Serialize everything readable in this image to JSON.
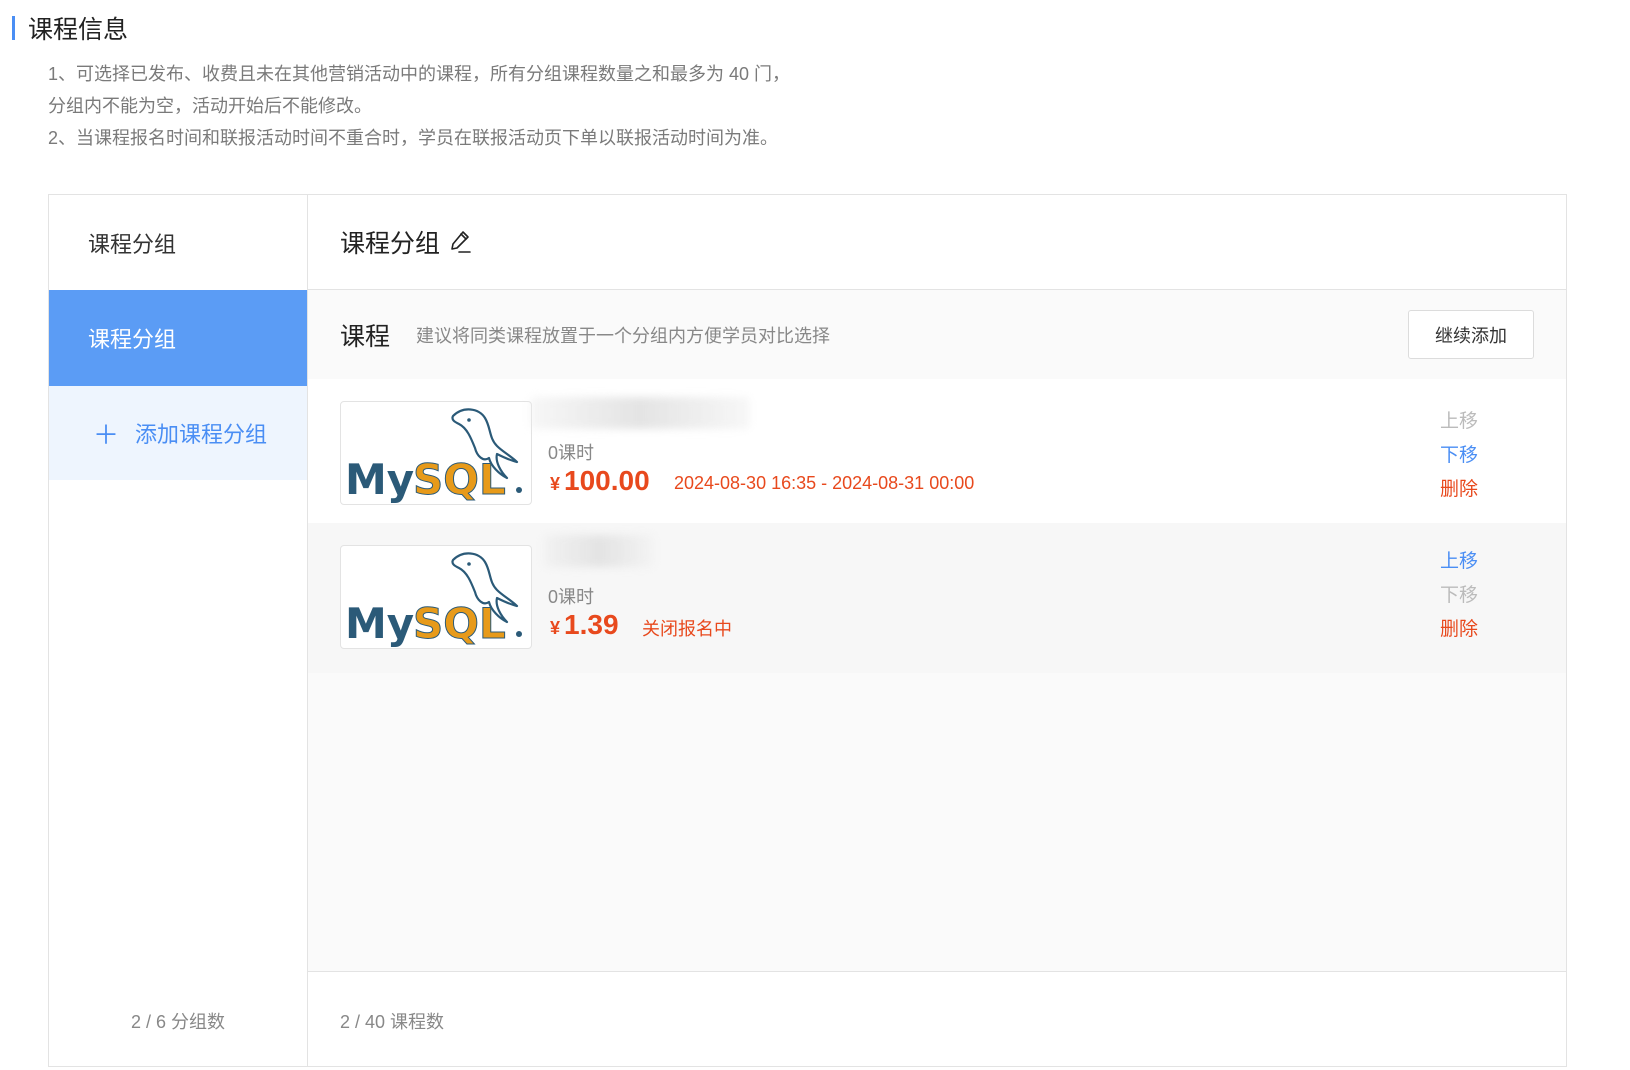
{
  "section": {
    "title": "课程信息",
    "notes": [
      "1、可选择已发布、收费且未在其他营销活动中的课程，所有分组课程数量之和最多为 40 门，",
      "分组内不能为空，活动开始后不能修改。",
      "2、当课程报名时间和联报活动时间不重合时，学员在联报活动页下单以联报活动时间为准。"
    ]
  },
  "sidebar": {
    "header": "课程分组",
    "items": [
      {
        "label": "课程分组"
      }
    ],
    "add_label": "添加课程分组",
    "footer": "2 / 6 分组数"
  },
  "main": {
    "group_title": "课程分组",
    "toolbar": {
      "title": "课程",
      "hint": "建议将同类课程放置于一个分组内方便学员对比选择",
      "add_button": "继续添加"
    },
    "courses": [
      {
        "hours": "0课时",
        "currency": "¥",
        "price": "100.00",
        "status": "2024-08-30 16:35 - 2024-08-31 00:00",
        "actions": {
          "up": "上移",
          "down": "下移",
          "delete": "删除"
        }
      },
      {
        "hours": "0课时",
        "currency": "¥",
        "price": "1.39",
        "status": "关闭报名中",
        "actions": {
          "up": "上移",
          "down": "下移",
          "delete": "删除"
        }
      }
    ],
    "footer": "2 / 40 课程数"
  },
  "icons": {
    "edit": "pencil-icon",
    "add": "plus-icon",
    "thumbnail": "mysql-logo"
  },
  "colors": {
    "accent": "#4a8ef4",
    "active_item": "#5b9cf5",
    "price": "#e8491d",
    "disabled": "#bbbbbb"
  }
}
